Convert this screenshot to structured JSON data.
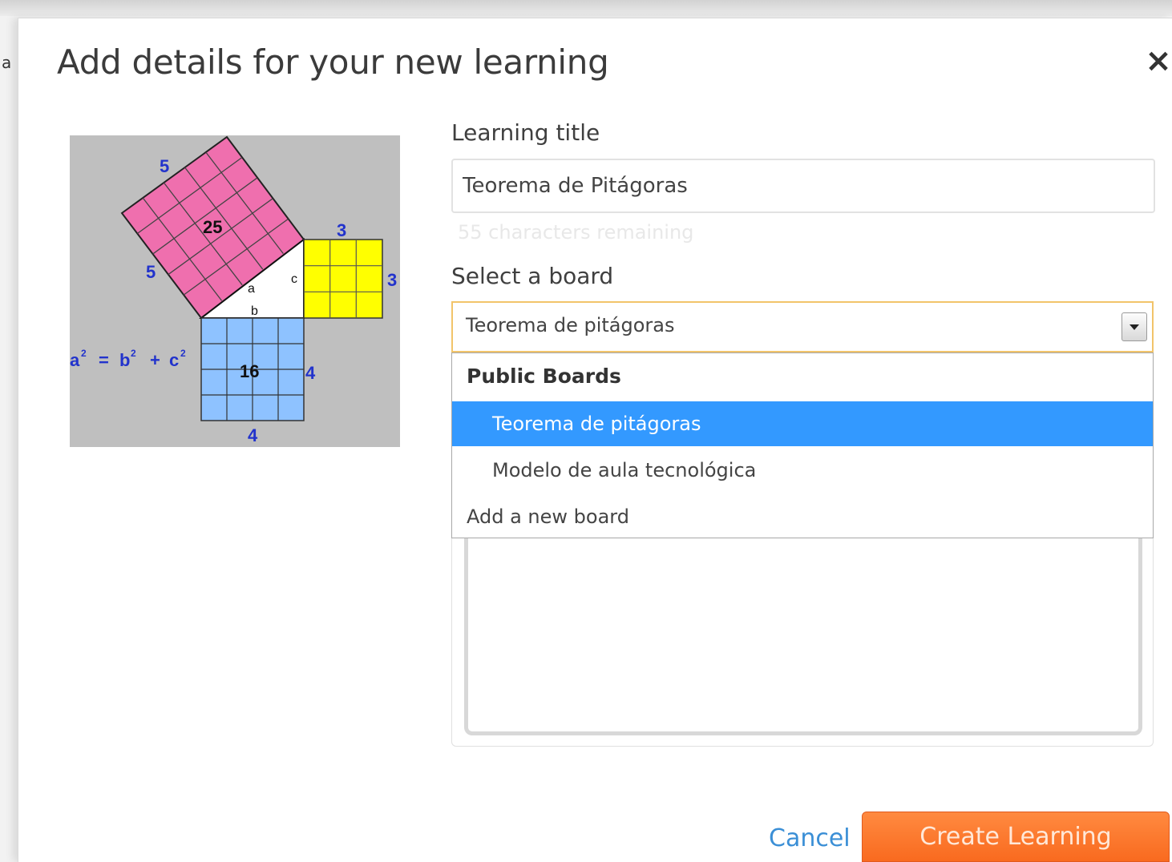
{
  "background": {
    "fragment": "a"
  },
  "dialog": {
    "title": "Add details for your new learning",
    "close": "×"
  },
  "thumbnail": {
    "top_left": "5",
    "top_bottom": "5",
    "big_area": "25",
    "yellow_top": "3",
    "yellow_right": "3",
    "blue_area": "16",
    "blue_right": "4",
    "blue_bottom": "4",
    "side_a": "a",
    "side_b": "b",
    "side_c": "c",
    "formula_a": "a",
    "formula_eq": "=",
    "formula_b": "b",
    "formula_plus": "+",
    "formula_c": "c",
    "exp": "2",
    "colors": {
      "pink": "#ef6fae",
      "yellow": "#ffff00",
      "blue": "#8ec2ff",
      "bg": "#bfbfbf",
      "label_blue": "#2233cc"
    }
  },
  "form": {
    "title_label": "Learning title",
    "title_value": "Teorema de Pitágoras",
    "chars_remaining": "55 characters remaining",
    "board_label": "Select a board",
    "board_selected": "Teorema de pitágoras",
    "dropdown": {
      "group": "Public Boards",
      "options": [
        "Teorema de pitágoras",
        "Modelo de aula tecnológica"
      ],
      "add": "Add a new board"
    }
  },
  "footer": {
    "cancel": "Cancel",
    "create": "Create Learning"
  },
  "colors": {
    "accent": "#f96a1f",
    "link": "#3b8fd6",
    "selected": "#3399ff",
    "focus_border": "#f2c46a"
  }
}
